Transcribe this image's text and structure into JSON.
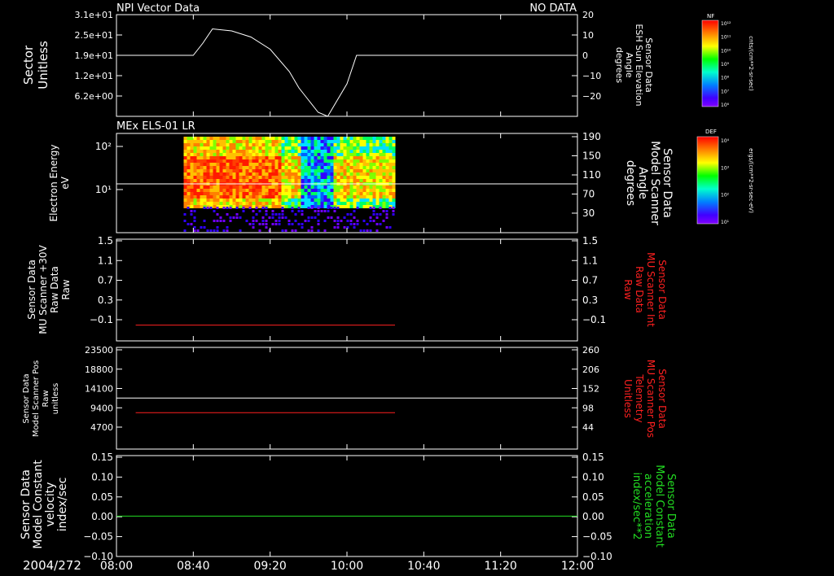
{
  "chart_data": [
    {
      "type": "line",
      "title_left": "NPI Vector Data",
      "title_right": "NO DATA",
      "ylabel_left": [
        "Sector",
        "Unitless"
      ],
      "ylabel_right": [
        "Sensor Data",
        "ESH Sun Elevation",
        "Angle",
        "degrees"
      ],
      "yticks_left": [
        "3.1e+01",
        "2.5e+01",
        "1.9e+01",
        "1.2e+01",
        "6.2e+00"
      ],
      "yticks_right": [
        "20",
        "10",
        "0",
        "−10",
        "−20"
      ],
      "ylim_right": [
        -30,
        20
      ],
      "series": [
        {
          "color": "#ffffff",
          "x": [
            "08:00",
            "08:35",
            "08:40",
            "08:45",
            "08:50",
            "09:00",
            "09:10",
            "09:20",
            "09:30",
            "09:35",
            "09:40",
            "09:45",
            "09:50",
            "10:00",
            "10:05",
            "10:10",
            "12:00"
          ],
          "values": [
            0,
            0,
            0,
            6,
            13,
            12,
            9,
            3,
            -8,
            -16,
            -22,
            -28,
            -30,
            -14,
            0,
            0,
            0
          ]
        }
      ]
    },
    {
      "type": "heatmap",
      "title": "MEx ELS-01 LR",
      "ylabel_left": [
        "Electron Energy",
        "eV"
      ],
      "ylabel_right": [
        "Sensor Data",
        "Model Scanner",
        "Angle",
        "degrees"
      ],
      "yticks_left": [
        "10²",
        "10¹"
      ],
      "yticks_right": [
        "190",
        "150",
        "110",
        "70",
        "30"
      ],
      "time_range": [
        "08:35",
        "10:25"
      ],
      "overlay_line": {
        "color": "#ffffff",
        "value_deg": 97
      }
    },
    {
      "type": "line",
      "ylabel_left": [
        "Sensor Data",
        "MU Scanner +30V",
        "Raw Data",
        "Raw"
      ],
      "ylabel_right": [
        "Sensor Data",
        "MU Scanner Int",
        "Raw Data",
        "Raw"
      ],
      "yticks_left": [
        "1.5",
        "1.1",
        "0.7",
        "0.3",
        "−0.1"
      ],
      "yticks_right": [
        "1.5",
        "1.1",
        "0.7",
        "0.3",
        "−0.1"
      ],
      "ylim": [
        -0.3,
        1.5
      ],
      "series": [
        {
          "color": "#ff2020",
          "x": [
            "08:10",
            "10:25"
          ],
          "values": [
            -0.02,
            -0.02
          ]
        }
      ]
    },
    {
      "type": "line",
      "ylabel_left": [
        "Sensor Data",
        "Model Scanner Pos",
        "Raw",
        "unitless"
      ],
      "ylabel_right": [
        "Sensor Data",
        "MU Scanner Pos",
        "Telemetry",
        "Unitless"
      ],
      "yticks_left": [
        "23500",
        "18800",
        "14100",
        "9400",
        "4700"
      ],
      "yticks_right": [
        "260",
        "206",
        "152",
        "98",
        "44"
      ],
      "ylim": [
        0,
        23500
      ],
      "series": [
        {
          "color": "#ffffff",
          "x": [
            "08:00",
            "12:00"
          ],
          "values": [
            11800,
            11800
          ]
        },
        {
          "color": "#ff2020",
          "x": [
            "08:10",
            "10:25"
          ],
          "values": [
            8400,
            8400
          ]
        }
      ]
    },
    {
      "type": "line",
      "ylabel_left": [
        "Sensor Data",
        "Model Constant",
        "velocity",
        "index/sec"
      ],
      "ylabel_right": [
        "Sensor Data",
        "Model Constant",
        "acceleration",
        "index/sec**2"
      ],
      "yticks_left": [
        "0.15",
        "0.10",
        "0.05",
        "0.00",
        "−0.05",
        "−0.10"
      ],
      "yticks_right": [
        "0.15",
        "0.10",
        "0.05",
        "0.00",
        "−0.05",
        "−0.10"
      ],
      "ylim": [
        -0.1,
        0.15
      ],
      "series": [
        {
          "color": "#22dd22",
          "x": [
            "08:00",
            "12:00"
          ],
          "values": [
            0,
            0
          ]
        }
      ]
    }
  ],
  "x_axis": {
    "date_label": "2004/272",
    "ticks": [
      "08:00",
      "08:40",
      "09:20",
      "10:00",
      "10:40",
      "11:20",
      "12:00"
    ],
    "range": [
      "08:00",
      "12:00"
    ]
  },
  "colorbars": [
    {
      "label": "NF",
      "unit": "cnts/(cm**2-sr-sec)",
      "ticks": [
        "10¹²",
        "10¹¹",
        "10¹⁰",
        "10⁹",
        "10⁸",
        "10⁷",
        "10⁶"
      ]
    },
    {
      "label": "DEF",
      "unit": "ergs/(cm**2-sr-sec-eV)",
      "ticks": [
        "10⁴",
        "10³",
        "10²",
        "10¹"
      ]
    }
  ],
  "colors": {
    "background": "#000000",
    "axes": "#ffffff",
    "red_label": "#ff2020",
    "green_label": "#22dd22"
  }
}
